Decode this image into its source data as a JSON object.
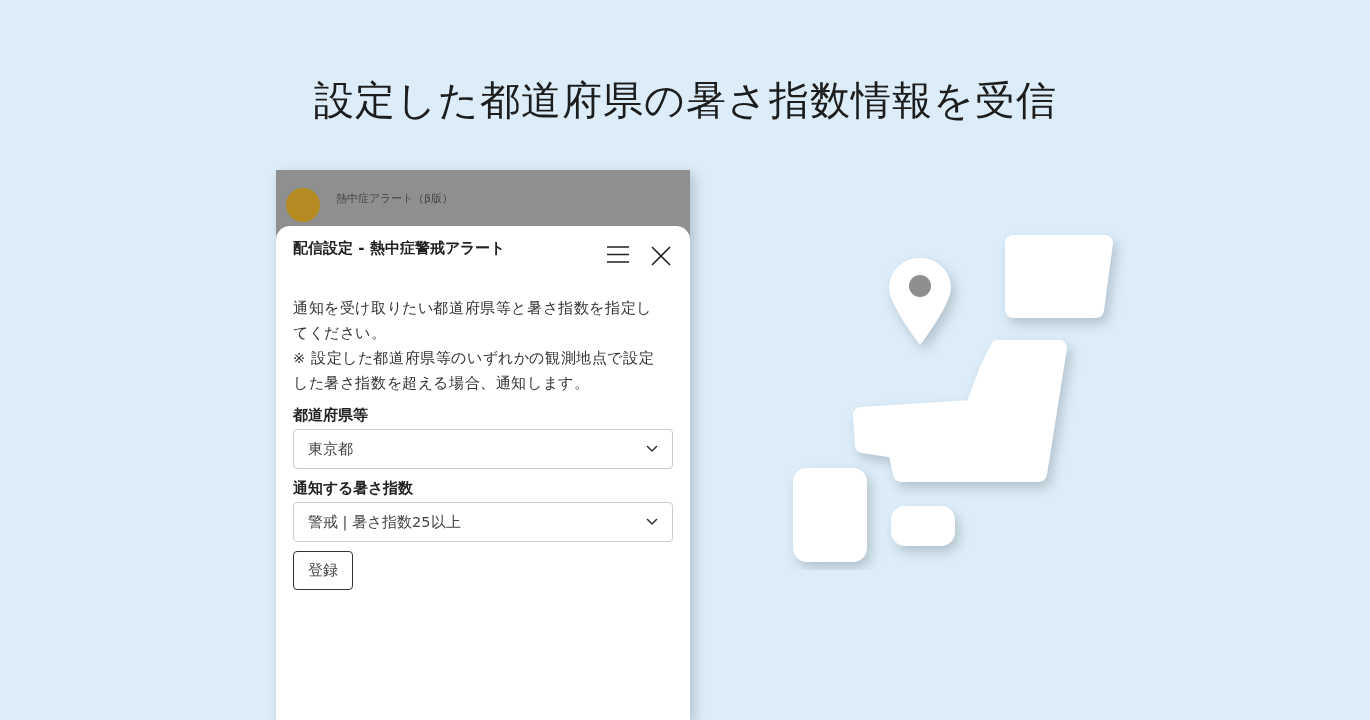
{
  "headline": "設定した都道府県の暑さ指数情報を受信",
  "chat": {
    "sender": "熱中症アラート（β版）"
  },
  "sheet": {
    "title": "配信設定 - 熱中症警戒アラート",
    "paragraphs": [
      "通知を受け取りたい都道府県等と暑さ指数を指定してください。",
      "※ 設定した都道府県等のいずれかの観測地点で設定した暑さ指数を超える場合、通知します。"
    ],
    "fields": [
      {
        "label": "都道府県等",
        "value": "東京都"
      },
      {
        "label": "通知する暑さ指数",
        "value": "警戒 | 暑さ指数25以上"
      }
    ],
    "submit": "登録"
  }
}
